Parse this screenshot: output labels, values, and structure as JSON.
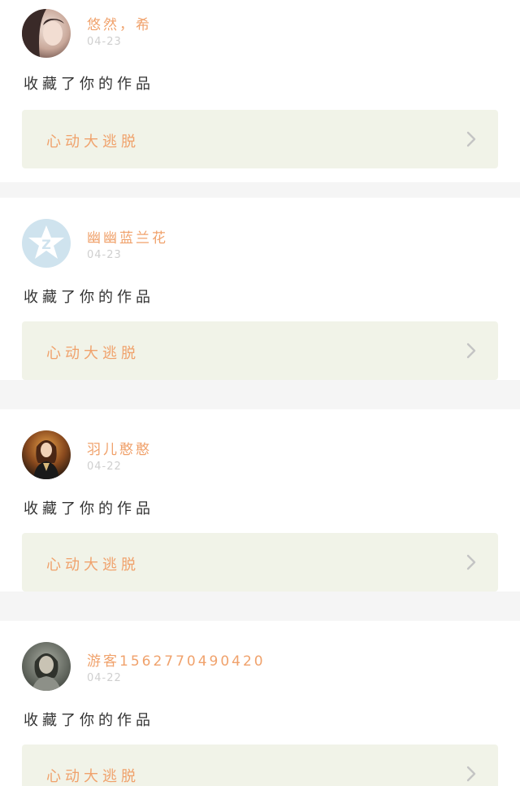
{
  "feed": {
    "items": [
      {
        "username": "悠然，希",
        "date": "04-23",
        "action": "收藏了你的作品",
        "work_title": "心动大逃脱",
        "avatar": "avatar-photo-girl"
      },
      {
        "username": "幽幽蓝兰花",
        "date": "04-23",
        "action": "收藏了你的作品",
        "work_title": "心动大逃脱",
        "avatar": "avatar-default-star"
      },
      {
        "username": "羽儿憨憨",
        "date": "04-22",
        "action": "收藏了你的作品",
        "work_title": "心动大逃脱",
        "avatar": "avatar-photo-costume"
      },
      {
        "username": "游客1562770490420",
        "date": "04-22",
        "action": "收藏了你的作品",
        "work_title": "心动大逃脱",
        "avatar": "avatar-photo-dark"
      }
    ]
  },
  "colors": {
    "username": "#f0a26c",
    "date": "#cfcfcf",
    "work_bg": "#f1f3e8",
    "separator": "#f5f5f5"
  }
}
